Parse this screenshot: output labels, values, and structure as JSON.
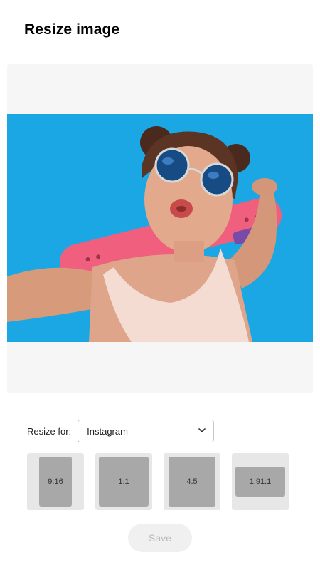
{
  "header": {
    "title": "Resize image"
  },
  "resize": {
    "label": "Resize for:",
    "selected": "Instagram"
  },
  "ratios": [
    {
      "label": "9:16"
    },
    {
      "label": "1:1"
    },
    {
      "label": "4:5"
    },
    {
      "label": "1.91:1"
    }
  ],
  "footer": {
    "save_label": "Save",
    "save_enabled": false
  },
  "icons": {
    "dropdown": "chevron-down-icon"
  },
  "colors": {
    "photo_background": "#1aa7e3",
    "skateboard": "#f0607e",
    "save_disabled_bg": "#f0f0f0",
    "save_disabled_text": "#b8b8b8"
  }
}
